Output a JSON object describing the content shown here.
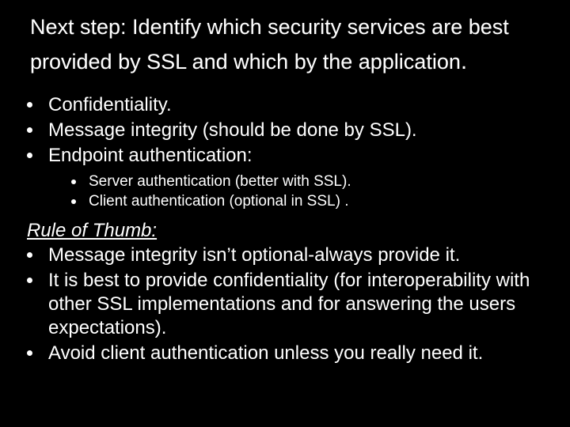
{
  "title_part1": "Next step: Identify which security services are best provided by SSL and which by the application",
  "title_period": ".",
  "bullets1": [
    "Confidentiality.",
    "Message integrity (should be done by SSL).",
    "Endpoint authentication:"
  ],
  "sub_bullets": [
    "Server authentication (better with SSL).",
    "Client authentication (optional in SSL) ."
  ],
  "rule_heading": "Rule of Thumb:",
  "bullets2": [
    "Message integrity isn’t optional-always provide it.",
    "It is best to provide confidentiality (for interoperability with other SSL implementations and for answering the users expectations).",
    "Avoid client authentication unless you really need it."
  ]
}
